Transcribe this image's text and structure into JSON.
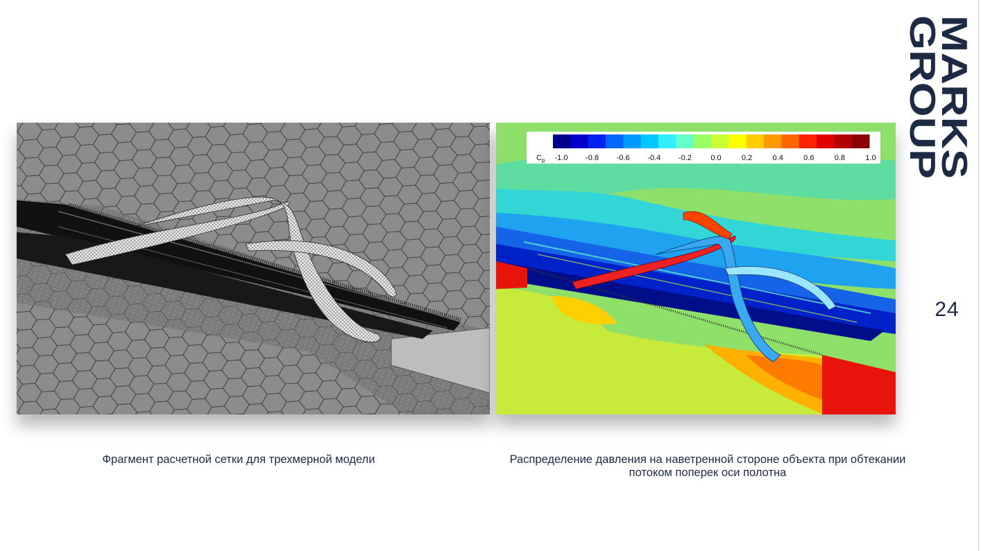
{
  "brand": {
    "line1": "MARKS",
    "line2": "GROUP",
    "color": "#1d2a44"
  },
  "page_number": "24",
  "figures": {
    "left": {
      "caption": "Фрагмент расчетной сетки для трехмерной модели"
    },
    "right": {
      "caption": "Распределение давления на наветренной стороне объекта при обтекании потоком поперек оси полотна",
      "legend": {
        "variable": "C",
        "variable_subscript": "p",
        "ticks": [
          "-1.0",
          "-0.8",
          "-0.6",
          "-0.4",
          "-0.2",
          "0.0",
          "0.2",
          "0.4",
          "0.6",
          "0.8",
          "1.0"
        ],
        "colors": [
          "#00008b",
          "#0000c8",
          "#0022f0",
          "#0066ff",
          "#0099ff",
          "#00c8ff",
          "#33eeff",
          "#66ffcc",
          "#99ff66",
          "#ccff33",
          "#ffff00",
          "#ffcc00",
          "#ff9900",
          "#ff6600",
          "#ff2200",
          "#e00000",
          "#b40000",
          "#8b0000"
        ]
      }
    }
  }
}
